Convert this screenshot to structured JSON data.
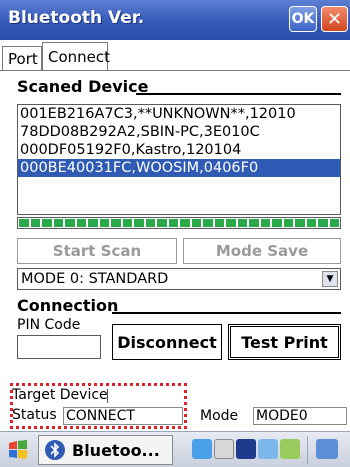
{
  "window": {
    "title": "Bluetooth Ver.",
    "ok_label": "OK",
    "close_label": "✕"
  },
  "tabs": [
    {
      "label": "Port",
      "active": false
    },
    {
      "label": "Connect",
      "active": true
    }
  ],
  "scanned_device": {
    "label": "Scaned Device",
    "items": [
      {
        "text": "001EB216A7C3,**UNKNOWN**,12010",
        "selected": false
      },
      {
        "text": "78DD08B292A2,SBIN-PC,3E010C",
        "selected": false
      },
      {
        "text": "000DF05192F0,Kastro,120104",
        "selected": false
      },
      {
        "text": "000BE40031FC,WOOSIM,0406F0",
        "selected": true
      }
    ],
    "progress": 1.0
  },
  "buttons": {
    "start_scan": "Start Scan",
    "mode_save": "Mode Save",
    "disconnect": "Disconnect",
    "test_print": "Test Print"
  },
  "mode_select": {
    "value": "MODE 0: STANDARD"
  },
  "connection": {
    "label": "Connection",
    "pin_label": "PIN Code",
    "pin_value": ""
  },
  "status": {
    "target_label": "Target Device",
    "status_label": "Status",
    "status_value": "CONNECT",
    "mode_label": "Mode",
    "mode_value": "MODE0"
  },
  "taskbar": {
    "app_label": "Bluetoo..."
  },
  "colors": {
    "titlebar": "#3559b8",
    "selection": "#2f5bb5",
    "progress": "#2aa94b",
    "highlight": "#e0202a"
  },
  "icons": [
    "start-logo-icon",
    "bluetooth-icon",
    "keyboard-icon",
    "network-icon",
    "sync-icon",
    "system-icon"
  ]
}
